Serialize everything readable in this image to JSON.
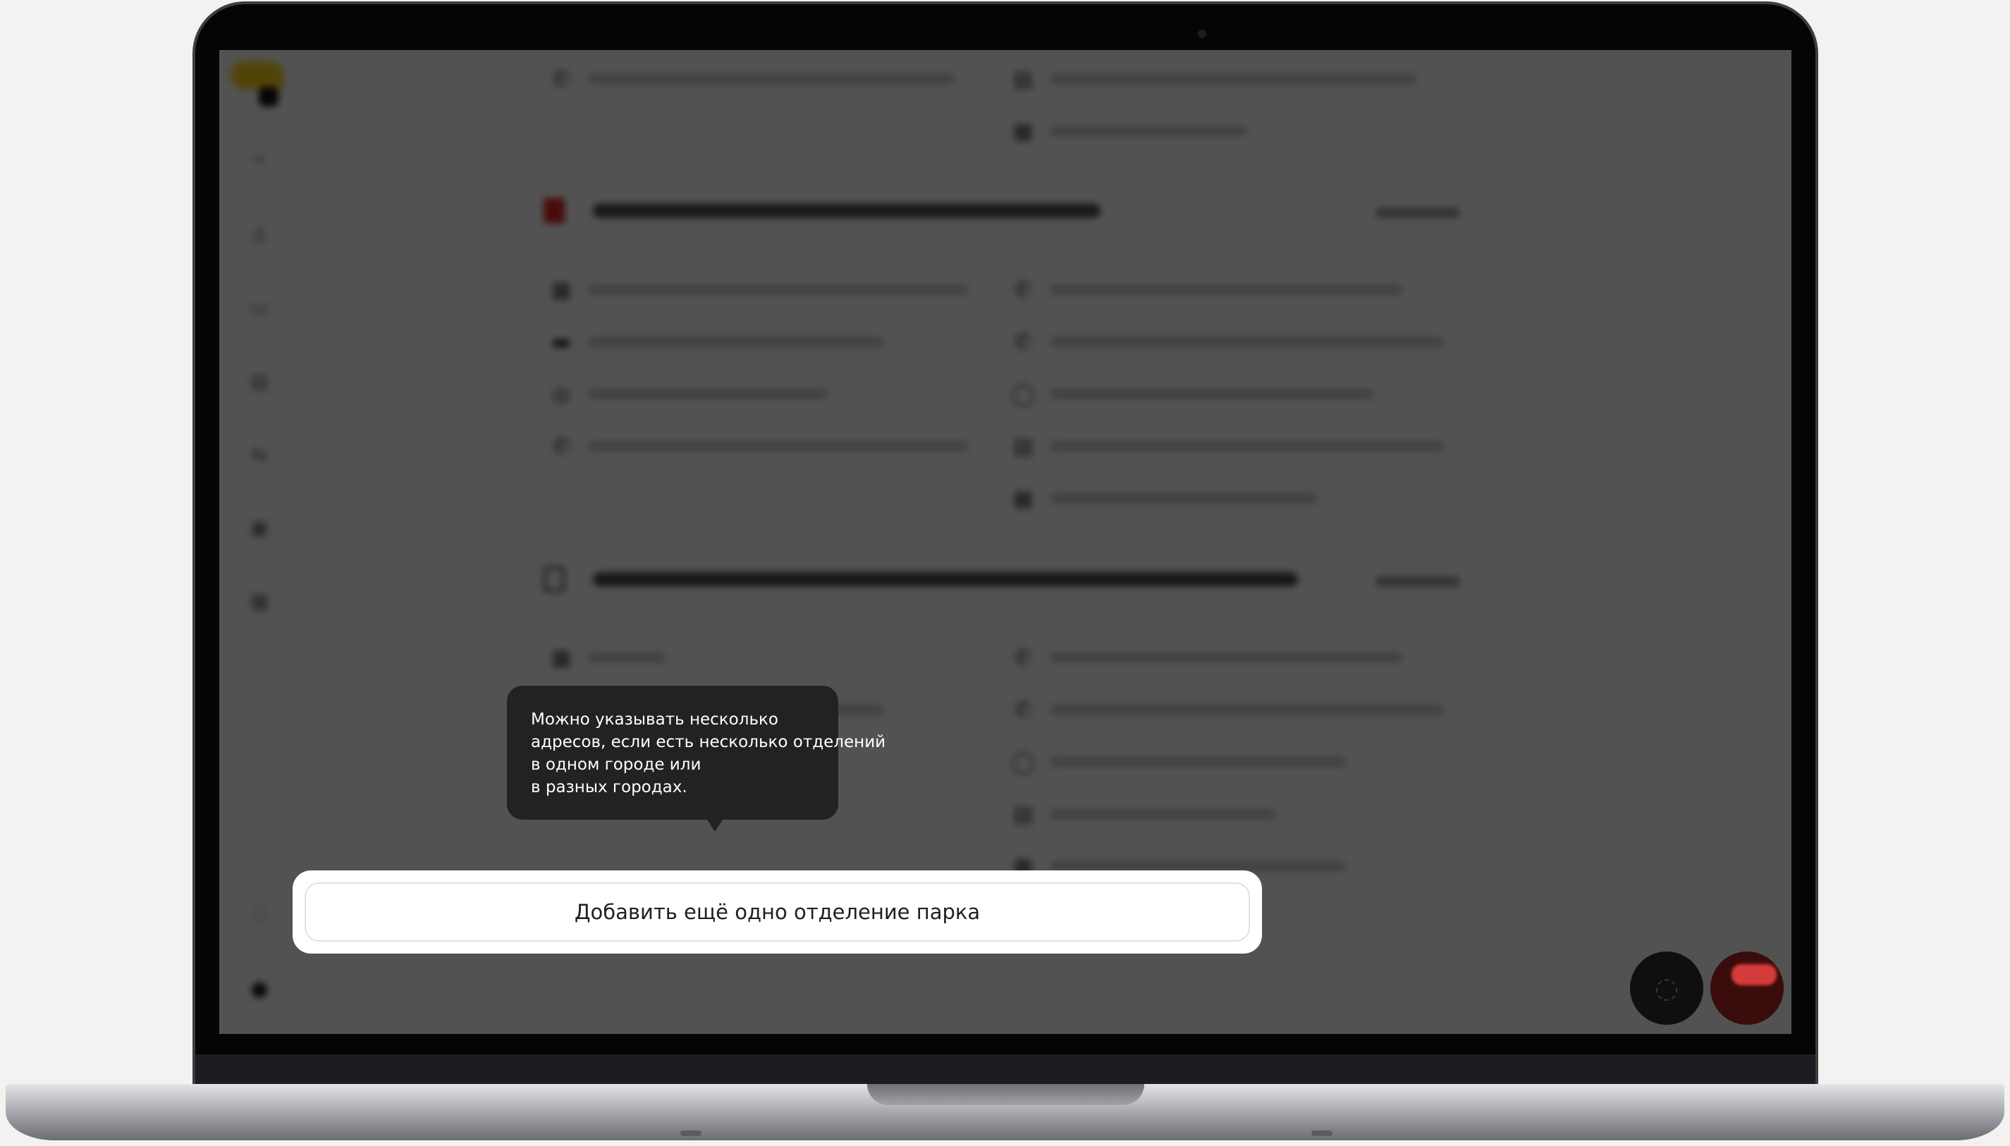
{
  "tooltip": {
    "lines": [
      "Можно указывать несколько",
      "адресов, если есть несколько отделений",
      "в одном городе или",
      "в разных городах."
    ]
  },
  "main": {
    "add_branch_button": "Добавить ещё одно отделение парка"
  },
  "sidebar": {
    "icons": [
      "logo",
      "chart-icon",
      "person-icon",
      "card-icon",
      "document-icon",
      "transfer-icon",
      "car-icon",
      "calendar-icon",
      "help-icon",
      "settings-icon"
    ]
  },
  "floating": {
    "chat_icon": "chat-icon",
    "avatar": "user-avatar"
  },
  "colors": {
    "tooltip_bg": "#222222",
    "overlay": "rgba(0,0,0,0.68)",
    "button_text": "#21201f",
    "brand_yellow": "#ffd21e"
  }
}
